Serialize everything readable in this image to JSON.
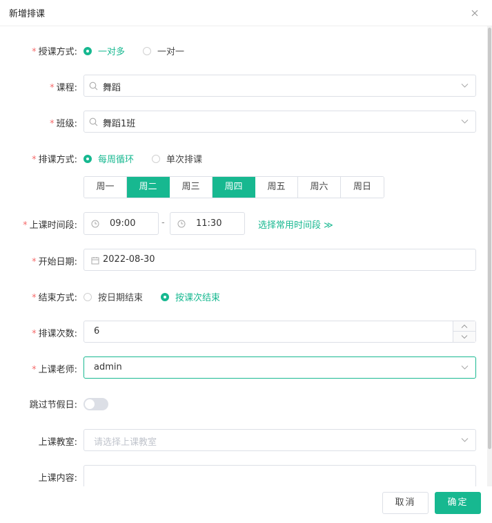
{
  "dialog": {
    "title": "新增排课"
  },
  "form": {
    "teach_mode": {
      "label": "授课方式:",
      "options": [
        {
          "label": "一对多",
          "checked": true
        },
        {
          "label": "一对一",
          "checked": false
        }
      ]
    },
    "course": {
      "label": "课程:",
      "value": "舞蹈"
    },
    "class": {
      "label": "班级:",
      "value": "舞蹈1班"
    },
    "schedule_mode": {
      "label": "排课方式:",
      "options": [
        {
          "label": "每周循环",
          "checked": true
        },
        {
          "label": "单次排课",
          "checked": false
        }
      ]
    },
    "weekdays": [
      {
        "label": "周一",
        "active": false
      },
      {
        "label": "周二",
        "active": true
      },
      {
        "label": "周三",
        "active": false
      },
      {
        "label": "周四",
        "active": true
      },
      {
        "label": "周五",
        "active": false
      },
      {
        "label": "周六",
        "active": false
      },
      {
        "label": "周日",
        "active": false
      }
    ],
    "time_range": {
      "label": "上课时间段:",
      "start": "09:00",
      "separator": "-",
      "end": "11:30",
      "link": "选择常用时间段 ≫"
    },
    "start_date": {
      "label": "开始日期:",
      "value": "2022-08-30"
    },
    "end_mode": {
      "label": "结束方式:",
      "options": [
        {
          "label": "按日期结束",
          "checked": false
        },
        {
          "label": "按课次结束",
          "checked": true
        }
      ]
    },
    "lesson_count": {
      "label": "排课次数:",
      "value": "6"
    },
    "teacher": {
      "label": "上课老师:",
      "value": "admin"
    },
    "skip_holidays": {
      "label": "跳过节假日:",
      "on": false
    },
    "classroom": {
      "label": "上课教室:",
      "placeholder": "请选择上课教室"
    },
    "content": {
      "label": "上课内容:"
    }
  },
  "footer": {
    "cancel": "取消",
    "confirm": "确定"
  },
  "colors": {
    "accent": "#17b890",
    "required": "#f56c6c",
    "border": "#dcdfe6"
  },
  "icons": [
    "close-icon",
    "search-icon",
    "chevron-down-icon",
    "clock-icon",
    "calendar-icon",
    "chevron-up-icon"
  ]
}
